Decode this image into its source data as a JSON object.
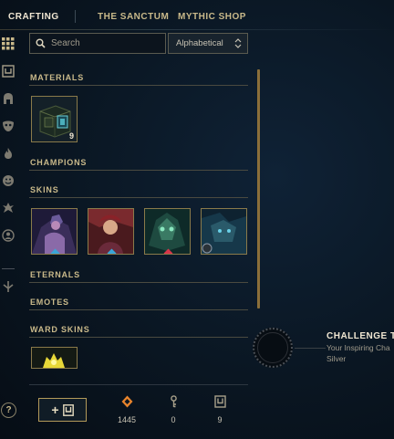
{
  "topnav": {
    "tabs": [
      {
        "label": "CRAFTING",
        "active": true
      },
      {
        "label": "THE SANCTUM",
        "active": false
      },
      {
        "label": "MYTHIC SHOP",
        "active": false
      }
    ]
  },
  "sidebar": {
    "icons": [
      "grid-icon",
      "chest-icon",
      "helmet-icon",
      "mask-icon",
      "flame-icon",
      "emote-face-icon",
      "ward-icon",
      "profile-icon",
      "eternals-icon"
    ],
    "help_label": "?"
  },
  "toolbar": {
    "search_placeholder": "Search",
    "sort_value": "Alphabetical"
  },
  "sections": {
    "materials": "MATERIALS",
    "champions": "CHAMPIONS",
    "skins": "SKINS",
    "eternals": "ETERNALS",
    "emotes": "EMOTES",
    "ward_skins": "WARD SKINS"
  },
  "materials_items": [
    {
      "name": "Masterwork Chest",
      "quantity": "9"
    }
  ],
  "skin_items": [
    {
      "rarity_color": "#3aa6d8"
    },
    {
      "rarity_color": "#3aa6d8"
    },
    {
      "rarity_color": "#d8364a"
    },
    {
      "rarity_color": "#8c98a8"
    }
  ],
  "currencies": [
    {
      "icon": "orange-essence-icon",
      "value": "1445",
      "color": "#e8842c"
    },
    {
      "icon": "key-icon",
      "value": "0",
      "color": "#a8a08a"
    },
    {
      "icon": "chest-icon",
      "value": "9",
      "color": "#a8a08a"
    }
  ],
  "add_button": {
    "label": "+"
  },
  "challenge": {
    "title": "CHALLENGE T",
    "subtitle": "Your Inspiring Cha",
    "rank": "Silver"
  },
  "colors": {
    "gold": "#c9b98a",
    "border_gold": "#8a7a4a",
    "scroll": "#8b6f3a"
  }
}
